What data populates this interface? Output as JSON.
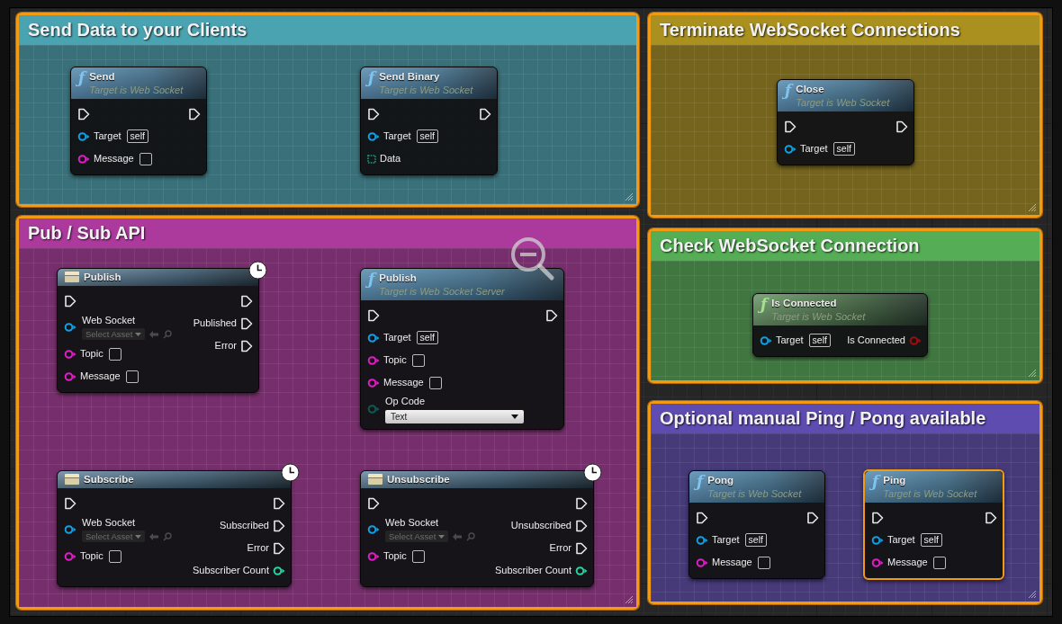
{
  "comments": [
    {
      "title": "Send Data to your Clients",
      "color": "#4aa3b1",
      "selected": true,
      "nodes": [
        {
          "kind": "function",
          "icon": "ƒ",
          "title": "Send",
          "subtitle": "Target is Web Socket",
          "selected": false,
          "latent": false,
          "inputs": [
            {
              "kind": "exec"
            },
            {
              "kind": "object",
              "label": "Target",
              "value": "self"
            },
            {
              "kind": "string",
              "label": "Message"
            }
          ],
          "outputs": [
            {
              "kind": "exec"
            }
          ]
        },
        {
          "kind": "function",
          "icon": "ƒ",
          "title": "Send Binary",
          "subtitle": "Target is Web Socket",
          "selected": false,
          "latent": false,
          "inputs": [
            {
              "kind": "exec"
            },
            {
              "kind": "object",
              "label": "Target",
              "value": "self"
            },
            {
              "kind": "binary",
              "label": "Data"
            }
          ],
          "outputs": [
            {
              "kind": "exec"
            }
          ]
        }
      ]
    },
    {
      "title": "Terminate WebSocket Connections",
      "color": "#a9901f",
      "selected": true,
      "nodes": [
        {
          "kind": "function",
          "icon": "ƒ",
          "title": "Close",
          "subtitle": "Target is Web Socket",
          "selected": false,
          "latent": false,
          "inputs": [
            {
              "kind": "exec"
            },
            {
              "kind": "object",
              "label": "Target",
              "value": "self"
            }
          ],
          "outputs": [
            {
              "kind": "exec"
            }
          ]
        }
      ]
    },
    {
      "title": "Pub / Sub API",
      "color": "#ac3a9c",
      "selected": true,
      "nodes": [
        {
          "kind": "macro",
          "title": "Publish",
          "selected": false,
          "latent": true,
          "inputs": [
            {
              "kind": "exec"
            },
            {
              "kind": "object",
              "label": "Web Socket",
              "picker": "Select Asset"
            },
            {
              "kind": "string",
              "label": "Topic"
            },
            {
              "kind": "string",
              "label": "Message"
            }
          ],
          "outputs": [
            {
              "kind": "exec"
            },
            {
              "kind": "exec",
              "label": "Published"
            },
            {
              "kind": "exec",
              "label": "Error"
            }
          ]
        },
        {
          "kind": "function",
          "icon": "ƒ",
          "title": "Publish",
          "subtitle": "Target is Web Socket Server",
          "selected": false,
          "latent": false,
          "inputs": [
            {
              "kind": "exec"
            },
            {
              "kind": "object",
              "label": "Target",
              "value": "self"
            },
            {
              "kind": "string",
              "label": "Topic"
            },
            {
              "kind": "string",
              "label": "Message"
            },
            {
              "kind": "enum",
              "label": "Op Code",
              "value": "Text"
            }
          ],
          "outputs": [
            {
              "kind": "exec"
            }
          ]
        },
        {
          "kind": "macro",
          "title": "Subscribe",
          "selected": false,
          "latent": true,
          "inputs": [
            {
              "kind": "exec"
            },
            {
              "kind": "object",
              "label": "Web Socket",
              "picker": "Select Asset"
            },
            {
              "kind": "string",
              "label": "Topic"
            }
          ],
          "outputs": [
            {
              "kind": "exec"
            },
            {
              "kind": "exec",
              "label": "Subscribed"
            },
            {
              "kind": "exec",
              "label": "Error"
            },
            {
              "kind": "int",
              "label": "Subscriber Count"
            }
          ]
        },
        {
          "kind": "macro",
          "title": "Unsubscribe",
          "selected": false,
          "latent": true,
          "inputs": [
            {
              "kind": "exec"
            },
            {
              "kind": "object",
              "label": "Web Socket",
              "picker": "Select Asset"
            },
            {
              "kind": "string",
              "label": "Topic"
            }
          ],
          "outputs": [
            {
              "kind": "exec"
            },
            {
              "kind": "exec",
              "label": "Unsubscribed"
            },
            {
              "kind": "exec",
              "label": "Error"
            },
            {
              "kind": "int",
              "label": "Subscriber Count"
            }
          ]
        }
      ]
    },
    {
      "title": "Check WebSocket Connection",
      "color": "#55ad55",
      "selected": true,
      "nodes": [
        {
          "kind": "pure",
          "icon": "ƒ",
          "title": "Is Connected",
          "subtitle": "Target is Web Socket",
          "selected": false,
          "latent": false,
          "inputs": [
            {
              "kind": "object",
              "label": "Target",
              "value": "self"
            }
          ],
          "outputs": [
            {
              "kind": "bool",
              "label": "Is Connected"
            }
          ]
        }
      ]
    },
    {
      "title": "Optional manual Ping / Pong available",
      "color": "#5f4cb0",
      "selected": true,
      "nodes": [
        {
          "kind": "function",
          "icon": "ƒ",
          "title": "Pong",
          "subtitle": "Target is Web Socket",
          "selected": false,
          "latent": false,
          "inputs": [
            {
              "kind": "exec"
            },
            {
              "kind": "object",
              "label": "Target",
              "value": "self"
            },
            {
              "kind": "string",
              "label": "Message"
            }
          ],
          "outputs": [
            {
              "kind": "exec"
            }
          ]
        },
        {
          "kind": "function",
          "icon": "ƒ",
          "title": "Ping",
          "subtitle": "Target is Web Socket",
          "selected": true,
          "latent": false,
          "inputs": [
            {
              "kind": "exec"
            },
            {
              "kind": "object",
              "label": "Target",
              "value": "self"
            },
            {
              "kind": "string",
              "label": "Message"
            }
          ],
          "outputs": [
            {
              "kind": "exec"
            }
          ]
        }
      ]
    }
  ]
}
